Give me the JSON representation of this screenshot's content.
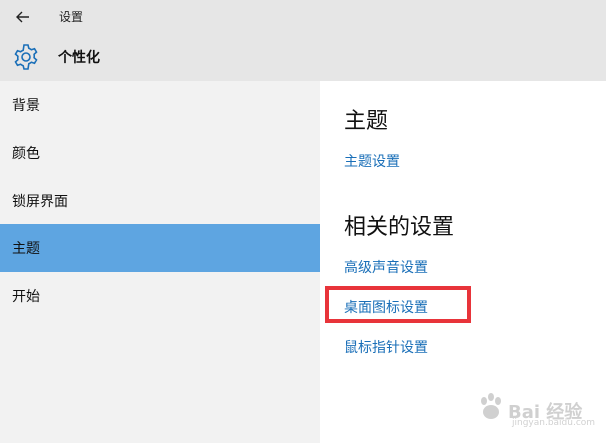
{
  "window": {
    "title": "设置"
  },
  "header": {
    "title": "个性化",
    "icon": "gear-icon"
  },
  "sidebar": {
    "items": [
      {
        "label": "背景"
      },
      {
        "label": "颜色"
      },
      {
        "label": "锁屏界面"
      },
      {
        "label": "主题"
      },
      {
        "label": "开始"
      }
    ],
    "selected": "主题"
  },
  "content": {
    "theme_heading": "主题",
    "theme_settings_link": "主题设置",
    "related_heading": "相关的设置",
    "related_links": [
      {
        "label": "高级声音设置"
      },
      {
        "label": "桌面图标设置"
      },
      {
        "label": "鼠标指针设置"
      }
    ]
  },
  "watermark": {
    "text": "Bai 经验",
    "subtext": "jingyan.baidu.com"
  },
  "colors": {
    "accent": "#5ea5e1",
    "link": "#1a6fb8",
    "highlight": "#e8343a",
    "header_bg": "#e6e6e6",
    "sidebar_bg": "#f2f2f2"
  }
}
